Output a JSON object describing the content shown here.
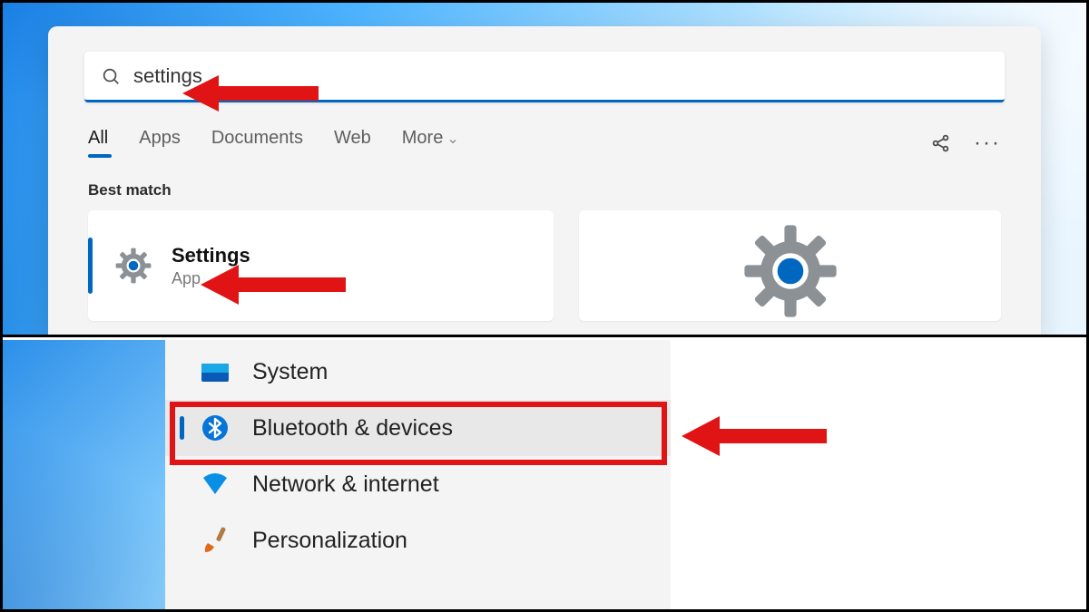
{
  "search": {
    "query": "settings",
    "tabs": [
      "All",
      "Apps",
      "Documents",
      "Web",
      "More"
    ],
    "active_tab": "All",
    "section_label": "Best match",
    "result": {
      "title": "Settings",
      "subtitle": "App"
    }
  },
  "settings_nav": {
    "items": [
      {
        "label": "System",
        "icon": "system"
      },
      {
        "label": "Bluetooth & devices",
        "icon": "bluetooth",
        "selected": true
      },
      {
        "label": "Network & internet",
        "icon": "wifi"
      },
      {
        "label": "Personalization",
        "icon": "paint"
      }
    ]
  },
  "colors": {
    "accent": "#0067c0",
    "annotation": "#e01414"
  }
}
